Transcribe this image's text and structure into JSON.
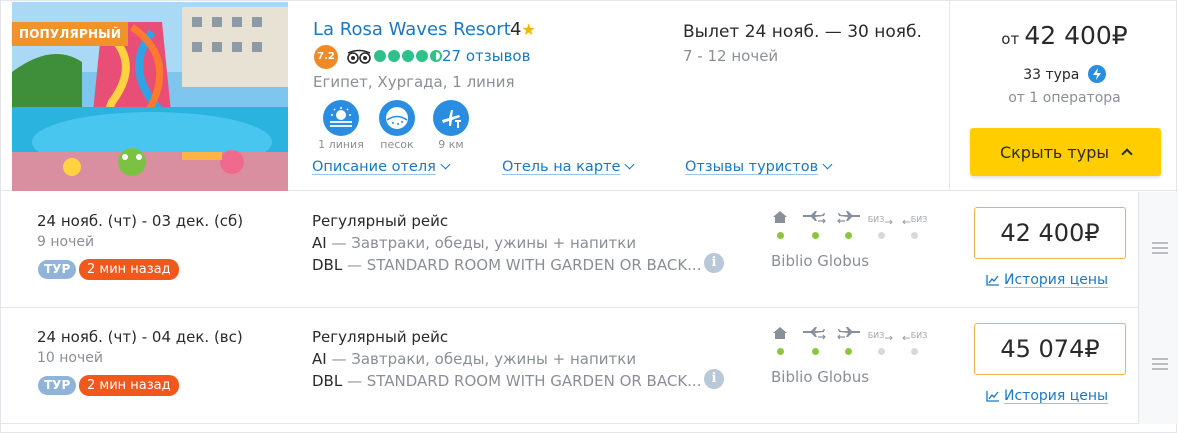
{
  "hotel": {
    "badge": "ПОПУЛЯРНЫЙ",
    "name": "La Rosa Waves Resort",
    "stars": "4",
    "rating": "7.2",
    "tripadvisor_score": 4.5,
    "reviews": "27 отзывов",
    "location": "Египет, Хургада, 1 линия",
    "features": [
      {
        "label": "1 линия",
        "icon": "beach-line-icon"
      },
      {
        "label": "песок",
        "icon": "sand-icon"
      },
      {
        "label": "9 км",
        "icon": "airport-distance-icon"
      }
    ],
    "links": {
      "description": "Описание отеля",
      "map": "Отель на карте",
      "reviews": "Отзывы туристов"
    },
    "departure": "Вылет 24 нояб. — 30 нояб.",
    "nights": "7 - 12 ночей",
    "price_prefix": "от",
    "price": "42 400",
    "currency": "₽",
    "tours_count": "33 тура",
    "operators": "от 1 оператора",
    "hide_button": "Скрыть туры",
    "brand_color": "#ffcd00",
    "link_color": "#1b78c2"
  },
  "tours": [
    {
      "dates": "24 нояб. (чт) - 03 дек. (сб)",
      "nights": "9 ночей",
      "badge": "ТУР",
      "updated": "2 мин назад",
      "flight": "Регулярный рейс",
      "meal_code": "AI",
      "meal": " — Завтраки, обеды, ужины + напитки",
      "room_code": "DBL",
      "room": " — STANDARD ROOM WITH GARDEN OR BACK...",
      "info": "i",
      "services": {
        "biz_label": "БИЗ",
        "items": [
          {
            "icon": "hotel-icon",
            "included": true
          },
          {
            "icon": "flight-there-icon",
            "included": true
          },
          {
            "icon": "flight-back-icon",
            "included": true
          },
          {
            "icon": "business-there-icon",
            "included": false
          },
          {
            "icon": "business-back-icon",
            "included": false
          }
        ]
      },
      "operator": "Biblio Globus",
      "price": "42 400",
      "currency": "₽",
      "history": "История цены"
    },
    {
      "dates": "24 нояб. (чт) - 04 дек. (вс)",
      "nights": "10 ночей",
      "badge": "ТУР",
      "updated": "2 мин назад",
      "flight": "Регулярный рейс",
      "meal_code": "AI",
      "meal": " — Завтраки, обеды, ужины + напитки",
      "room_code": "DBL",
      "room": " — STANDARD ROOM WITH GARDEN OR BACK...",
      "info": "i",
      "services": {
        "biz_label": "БИЗ",
        "items": [
          {
            "icon": "hotel-icon",
            "included": true
          },
          {
            "icon": "flight-there-icon",
            "included": true
          },
          {
            "icon": "flight-back-icon",
            "included": true
          },
          {
            "icon": "business-there-icon",
            "included": false
          },
          {
            "icon": "business-back-icon",
            "included": false
          }
        ]
      },
      "operator": "Biblio Globus",
      "price": "45 074",
      "currency": "₽",
      "history": "История цены"
    }
  ]
}
